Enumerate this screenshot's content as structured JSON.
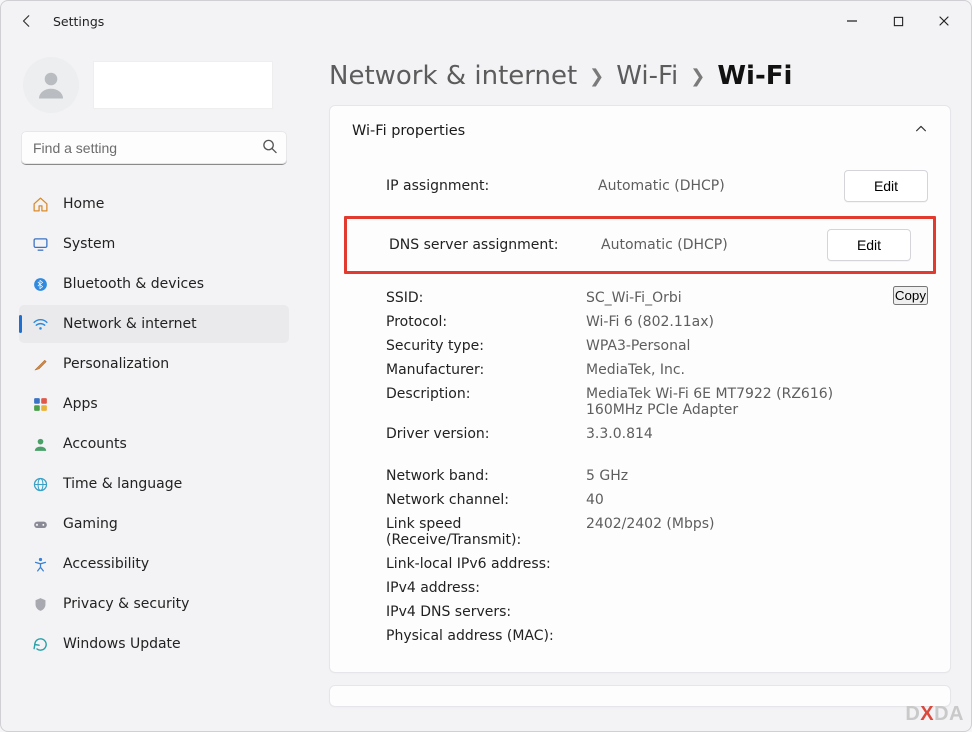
{
  "window": {
    "title": "Settings"
  },
  "search": {
    "placeholder": "Find a setting"
  },
  "sidebar": {
    "items": [
      {
        "label": "Home"
      },
      {
        "label": "System"
      },
      {
        "label": "Bluetooth & devices"
      },
      {
        "label": "Network & internet"
      },
      {
        "label": "Personalization"
      },
      {
        "label": "Apps"
      },
      {
        "label": "Accounts"
      },
      {
        "label": "Time & language"
      },
      {
        "label": "Gaming"
      },
      {
        "label": "Accessibility"
      },
      {
        "label": "Privacy & security"
      },
      {
        "label": "Windows Update"
      }
    ]
  },
  "breadcrumb": {
    "root": "Network & internet",
    "mid": "Wi-Fi",
    "current": "Wi-Fi"
  },
  "card": {
    "title": "Wi-Fi properties",
    "ip_assign": {
      "label": "IP assignment:",
      "value": "Automatic (DHCP)",
      "button": "Edit"
    },
    "dns_assign": {
      "label": "DNS server assignment:",
      "value": "Automatic (DHCP)",
      "button": "Edit"
    },
    "copy_button": "Copy",
    "props1": [
      {
        "k": "SSID:",
        "v": "SC_Wi-Fi_Orbi"
      },
      {
        "k": "Protocol:",
        "v": "Wi-Fi 6 (802.11ax)"
      },
      {
        "k": "Security type:",
        "v": "WPA3-Personal"
      },
      {
        "k": "Manufacturer:",
        "v": "MediaTek, Inc."
      },
      {
        "k": "Description:",
        "v": "MediaTek Wi-Fi 6E MT7922 (RZ616) 160MHz PCIe Adapter"
      },
      {
        "k": "Driver version:",
        "v": "3.3.0.814"
      }
    ],
    "props2": [
      {
        "k": "Network band:",
        "v": "5 GHz"
      },
      {
        "k": "Network channel:",
        "v": "40"
      },
      {
        "k": "Link speed (Receive/Transmit):",
        "v": "2402/2402 (Mbps)"
      },
      {
        "k": "Link-local IPv6 address:",
        "v": ""
      },
      {
        "k": "IPv4 address:",
        "v": ""
      },
      {
        "k": "IPv4 DNS servers:",
        "v": ""
      },
      {
        "k": "Physical address (MAC):",
        "v": ""
      }
    ]
  },
  "watermark": {
    "prefix": "D",
    "x": "X",
    "suffix": "DA"
  }
}
